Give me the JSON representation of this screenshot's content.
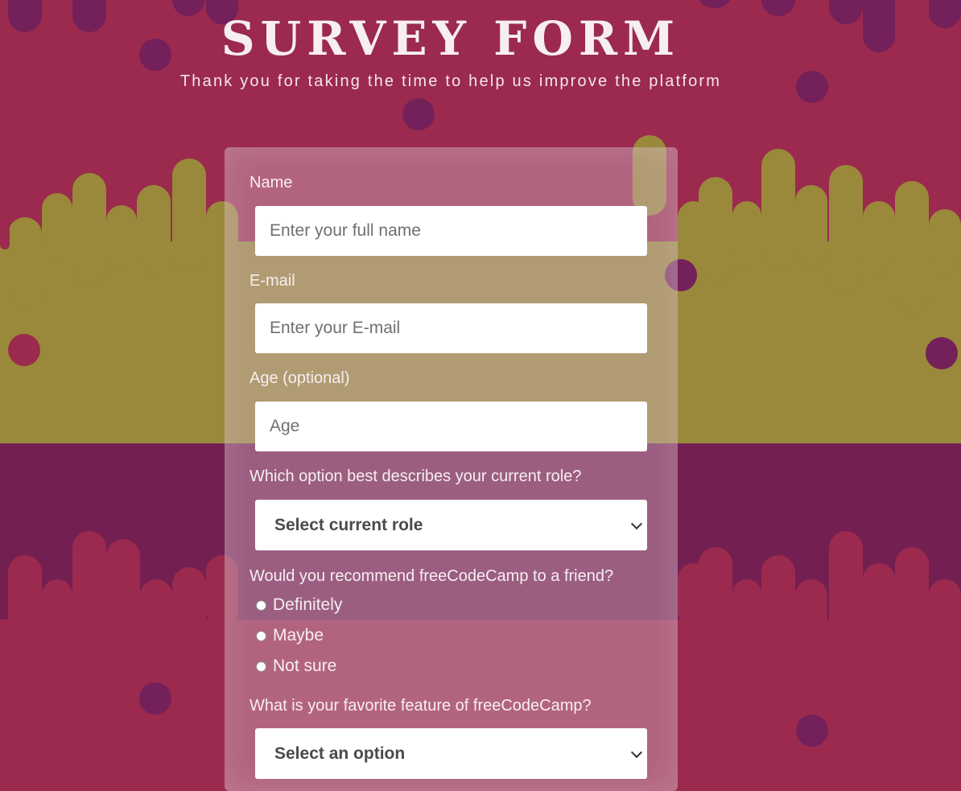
{
  "header": {
    "title": "SURVEY FORM",
    "subtitle": "Thank you for taking the time to help us improve the platform"
  },
  "colors": {
    "background": "#9b2a4e",
    "dots": "#74205a",
    "drip_band": "#9a893a",
    "lower_band": "#741f52",
    "card": "rgba(210,180,195,0.42)",
    "text": "#f7eef1"
  },
  "form": {
    "name": {
      "label": "Name",
      "placeholder": "Enter your full name"
    },
    "email": {
      "label": "E-mail",
      "placeholder": "Enter your E-mail"
    },
    "age": {
      "label": "Age (optional)",
      "placeholder": "Age"
    },
    "role": {
      "label": "Which option best describes your current role?",
      "selected": "Select current role"
    },
    "recommend": {
      "label": "Would you recommend freeCodeCamp to a friend?",
      "options": [
        "Definitely",
        "Maybe",
        "Not sure"
      ]
    },
    "feature": {
      "label": "What is your favorite feature of freeCodeCamp?",
      "selected": "Select an option"
    }
  }
}
